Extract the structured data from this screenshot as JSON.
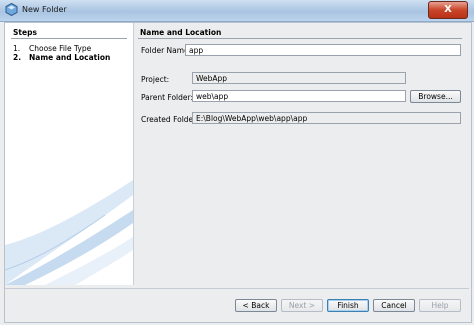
{
  "window": {
    "title": "New Folder",
    "close_glyph": "X"
  },
  "steps": {
    "heading": "Steps",
    "items": [
      {
        "num": "1.",
        "label": "Choose File Type"
      },
      {
        "num": "2.",
        "label": "Name and Location"
      }
    ]
  },
  "main": {
    "heading": "Name and Location",
    "folder_name": {
      "label": "Folder Name:",
      "value": "app"
    },
    "project": {
      "label": "Project:",
      "value": "WebApp"
    },
    "parent_folder": {
      "label": "Parent Folder:",
      "value": "web\\app"
    },
    "browse_label": "Browse...",
    "created_folder": {
      "label": "Created Folder:",
      "value": "E:\\Blog\\WebApp\\web\\app\\app"
    }
  },
  "footer": {
    "back": "< Back",
    "next": "Next >",
    "finish": "Finish",
    "cancel": "Cancel",
    "help": "Help"
  },
  "colors": {
    "accent": "#3c7fb1",
    "titlebar": "#a9c4e2",
    "close": "#c9452a"
  }
}
